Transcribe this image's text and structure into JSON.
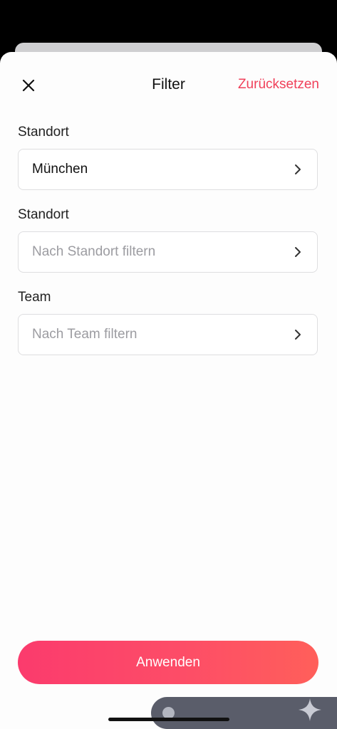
{
  "header": {
    "title": "Filter",
    "close_icon": "close-icon",
    "reset_label": "Zurücksetzen"
  },
  "fields": [
    {
      "label": "Standort",
      "value": "München",
      "placeholder": "",
      "icon": "chevron-right-icon"
    },
    {
      "label": "Standort",
      "value": "",
      "placeholder": "Nach Standort filtern",
      "icon": "chevron-right-icon"
    },
    {
      "label": "Team",
      "value": "",
      "placeholder": "Nach Team filtern",
      "icon": "chevron-right-icon"
    }
  ],
  "footer": {
    "apply_label": "Anwenden"
  },
  "colors": {
    "accent": "#f0405a",
    "button_gradient_start": "#fb3b6d",
    "button_gradient_end": "#ff5f5a",
    "field_border": "#dedee0",
    "placeholder_text": "#9c9ca1",
    "overlay_bar": "#5a5d6a"
  },
  "icons": {
    "floating_action": "sparkle-icon",
    "floating_handle": "drag-handle-icon"
  }
}
